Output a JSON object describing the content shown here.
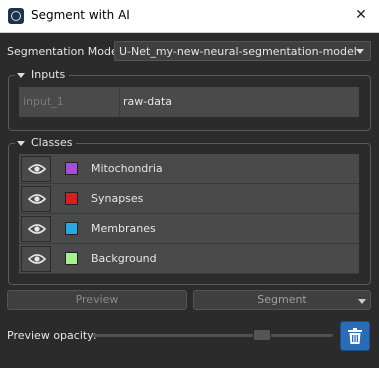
{
  "window": {
    "title": "Segment with AI",
    "icon": "app-logo-icon",
    "close_glyph": "✕"
  },
  "segmentation_model": {
    "label": "Segmentation Model:",
    "value": "U-Net_my-new-neural-segmentation-model"
  },
  "inputs": {
    "title": "Inputs",
    "rows": [
      {
        "name": "input_1",
        "value": "raw-data"
      }
    ]
  },
  "classes": {
    "title": "Classes",
    "items": [
      {
        "label": "Mitochondria",
        "color": "#a64de0"
      },
      {
        "label": "Synapses",
        "color": "#e01b1b"
      },
      {
        "label": "Membranes",
        "color": "#29a8e6"
      },
      {
        "label": "Background",
        "color": "#a8f08c"
      }
    ]
  },
  "buttons": {
    "preview": "Preview",
    "segment": "Segment"
  },
  "opacity": {
    "label": "Preview opacity:",
    "value_fraction": 0.72
  },
  "colors": {
    "accent": "#2b6cb8",
    "background": "#2b2b2b"
  }
}
